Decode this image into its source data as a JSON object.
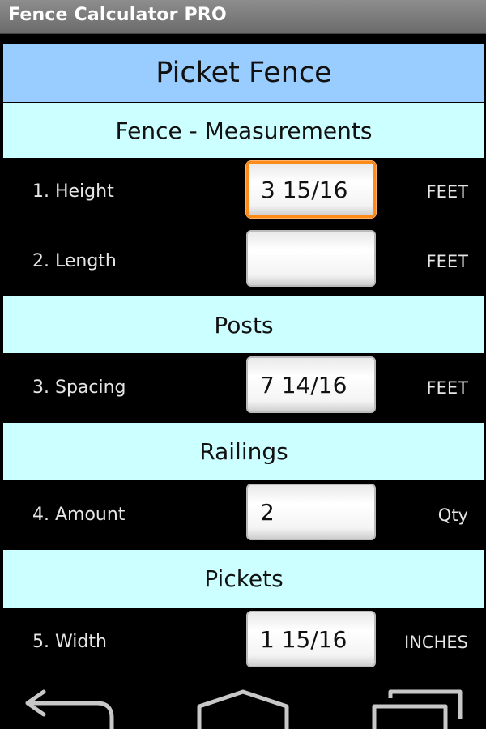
{
  "app": {
    "title": "Fence Calculator PRO"
  },
  "header": {
    "title": "Picket Fence"
  },
  "sections": [
    {
      "title": "Fence - Measurements",
      "rows": [
        {
          "label": "1. Height",
          "value": "3 15/16",
          "unit": "FEET",
          "focused": true
        },
        {
          "label": "2. Length",
          "value": "",
          "unit": "FEET",
          "focused": false
        }
      ]
    },
    {
      "title": "Posts",
      "rows": [
        {
          "label": "3. Spacing",
          "value": "7 14/16",
          "unit": "FEET",
          "focused": false
        }
      ]
    },
    {
      "title": "Railings",
      "rows": [
        {
          "label": "4. Amount",
          "value": "2",
          "unit": "Qty",
          "focused": false
        }
      ]
    },
    {
      "title": "Pickets",
      "rows": [
        {
          "label": "5. Width",
          "value": "1 15/16",
          "unit": "INCHES",
          "focused": false
        }
      ]
    }
  ],
  "navigation": {
    "buttons": [
      "back-icon",
      "home-icon",
      "recent-apps-icon"
    ]
  },
  "colors": {
    "header_bg": "#99ccff",
    "section_bg": "#ccffff",
    "row_bg": "#000000",
    "focus_border": "#ff8c1a",
    "titlebar_bg": "#7a7a7a"
  }
}
